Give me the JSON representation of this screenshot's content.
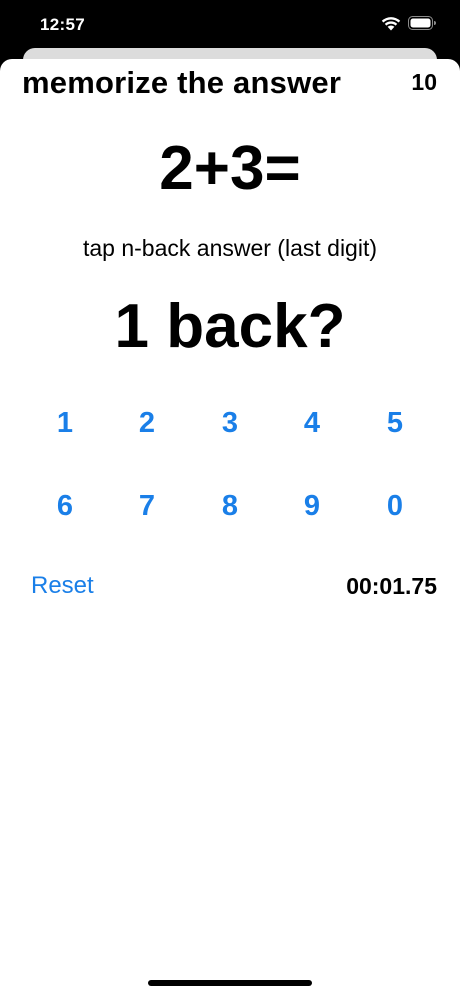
{
  "status_bar": {
    "time": "12:57"
  },
  "header": {
    "title": "memorize the answer",
    "counter": "10"
  },
  "main": {
    "equation": "2+3=",
    "instruction": "tap n-back answer (last digit)",
    "question": "1 back?"
  },
  "keypad": {
    "keys": [
      "1",
      "2",
      "3",
      "4",
      "5",
      "6",
      "7",
      "8",
      "9",
      "0"
    ]
  },
  "footer": {
    "reset_label": "Reset",
    "timer": "00:01.75"
  },
  "colors": {
    "accent": "#1a7fe8",
    "text": "#000000",
    "background": "#ffffff"
  }
}
